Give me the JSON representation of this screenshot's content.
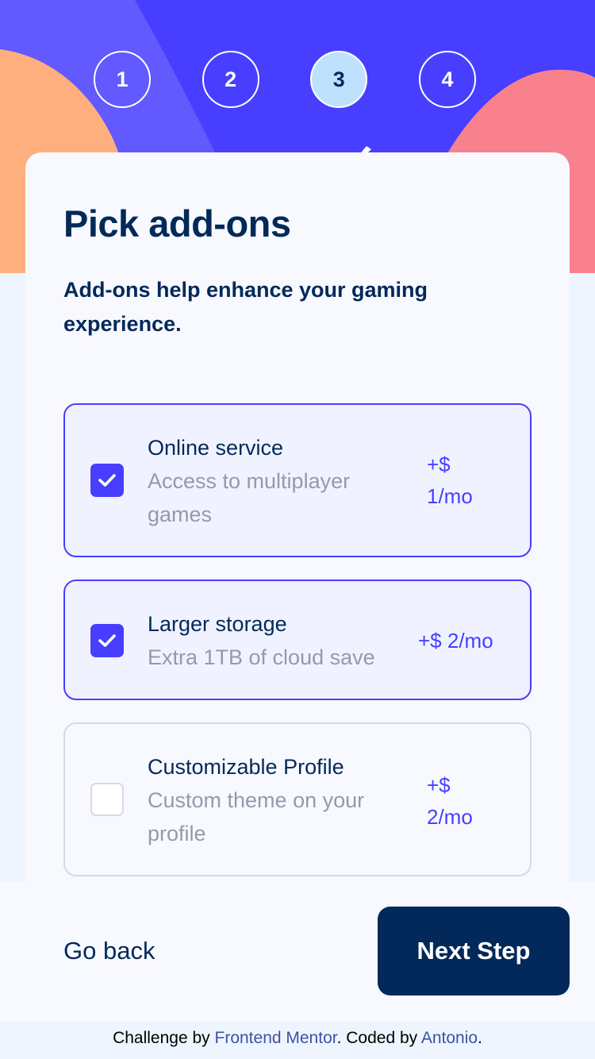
{
  "steps": [
    {
      "number": "1",
      "active": false
    },
    {
      "number": "2",
      "active": false
    },
    {
      "number": "3",
      "active": true
    },
    {
      "number": "4",
      "active": false
    }
  ],
  "card": {
    "title": "Pick add-ons",
    "description": "Add-ons help enhance your gaming experience."
  },
  "addons": [
    {
      "name": "Online service",
      "description": "Access to multiplayer games",
      "price": "+$ 1/mo",
      "checked": true
    },
    {
      "name": "Larger storage",
      "description": "Extra 1TB of cloud save",
      "price": "+$ 2/mo",
      "checked": true
    },
    {
      "name": "Customizable Profile",
      "description": "Custom theme on your profile",
      "price": "+$ 2/mo",
      "checked": false
    }
  ],
  "footer": {
    "back_label": "Go back",
    "next_label": "Next Step"
  },
  "attribution": {
    "prefix": "Challenge by ",
    "fm_link": "Frontend Mentor",
    "middle": ". Coded by ",
    "author_link": "Antonio",
    "suffix": "."
  },
  "colors": {
    "accent": "#483eff",
    "marine_blue": "#02295a",
    "cool_gray": "#9699ab",
    "light_blue": "#bee2fd",
    "orange": "#ffaf7e",
    "pink": "#f9818e"
  }
}
